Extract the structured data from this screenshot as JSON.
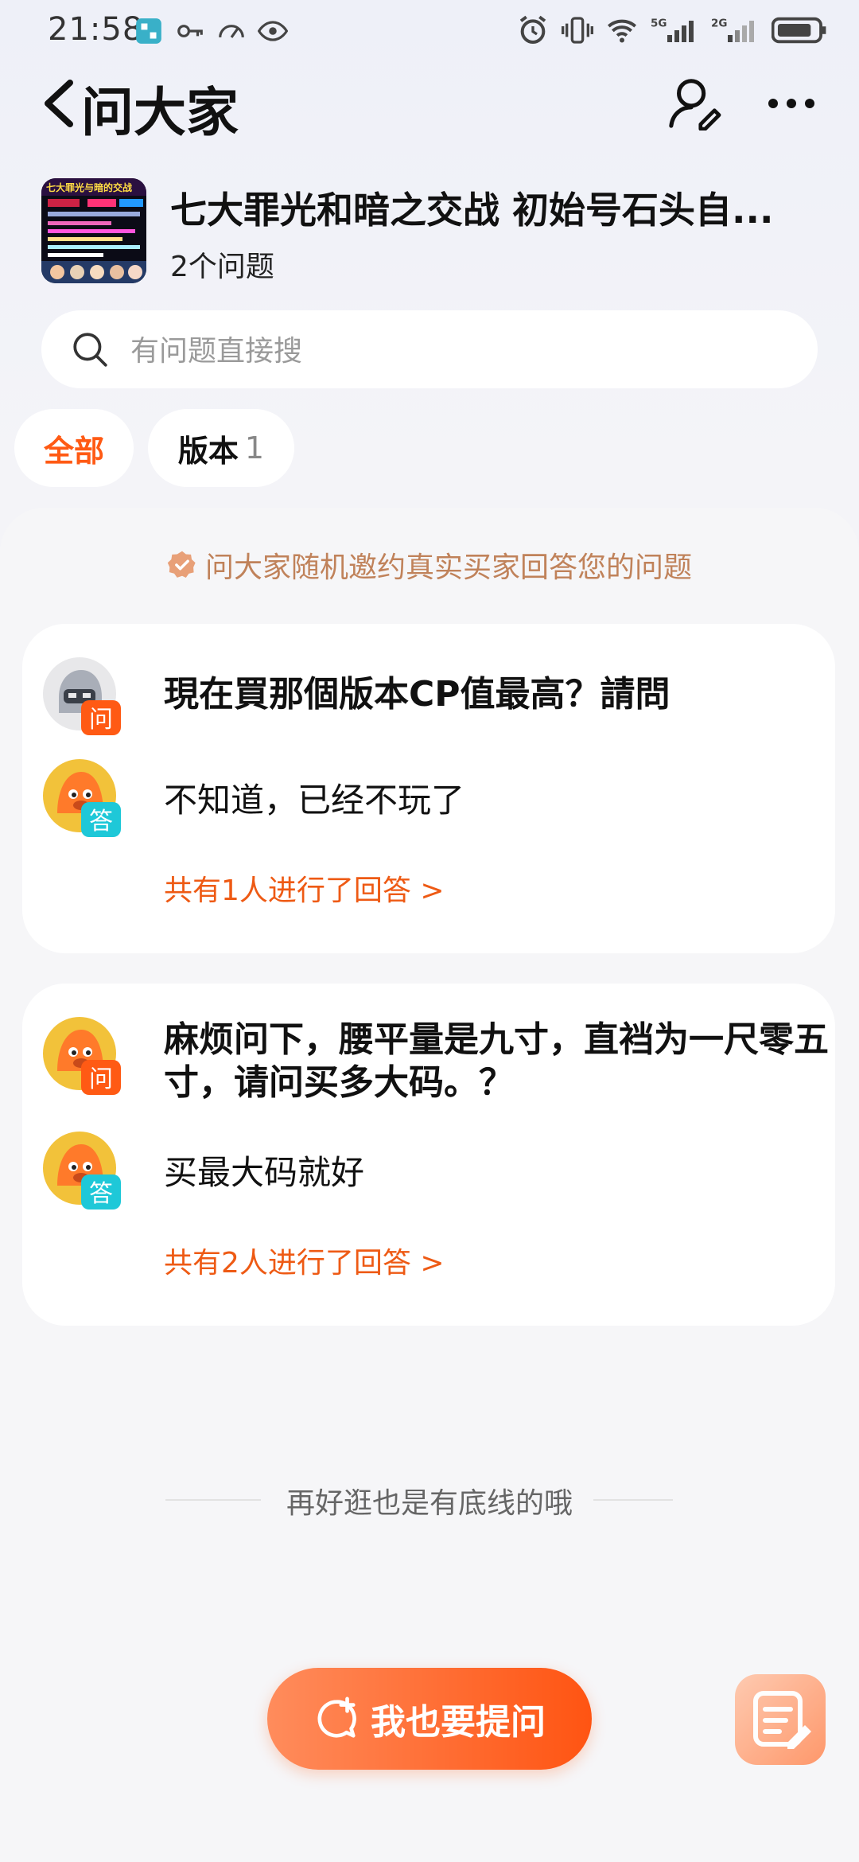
{
  "status_bar": {
    "time": "21:58",
    "network_5g": "5G",
    "network_2g": "2G"
  },
  "nav": {
    "title": "问大家"
  },
  "product": {
    "title": "七大罪光和暗之交战 初始号石头自...",
    "question_count": "2个问题",
    "thumb_text": "七大罪光与暗的交战"
  },
  "search": {
    "placeholder": "有问题直接搜"
  },
  "filters": [
    {
      "label": "全部",
      "count": ""
    },
    {
      "label": "版本",
      "count": "1"
    }
  ],
  "notice": "问大家随机邀约真实买家回答您的问题",
  "questions": [
    {
      "q_badge": "问",
      "question": "現在買那個版本CP值最高？請問",
      "a_badge": "答",
      "answer": "不知道，已经不玩了",
      "summary": "共有1人进行了回答 >"
    },
    {
      "q_badge": "问",
      "question": "麻烦问下，腰平量是九寸，直裆为一尺零五寸，请问买多大码。？",
      "a_badge": "答",
      "answer": "买最大码就好",
      "summary": "共有2人进行了回答 >"
    }
  ],
  "footer_text": "再好逛也是有底线的哦",
  "ask_button": "我也要提问",
  "colors": {
    "accent": "#ff5a14",
    "ask_badge": "#ff5a14",
    "answer_badge": "#1ec8d8",
    "notice": "#c0825a"
  }
}
